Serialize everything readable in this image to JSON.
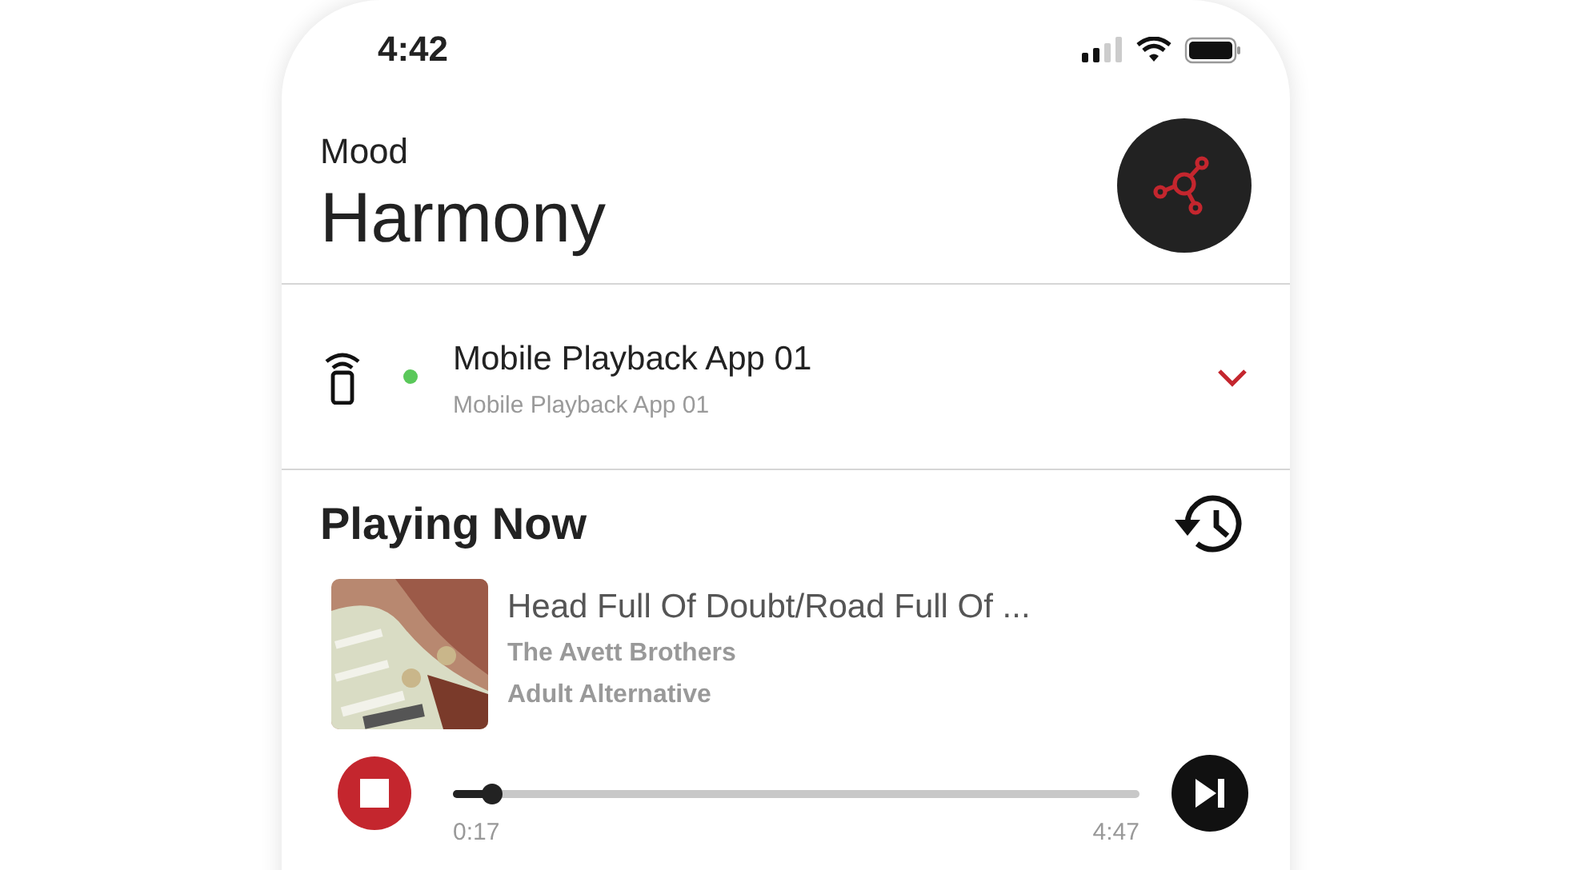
{
  "status_bar": {
    "time": "4:42"
  },
  "header": {
    "label": "Mood",
    "title": "Harmony"
  },
  "device": {
    "name": "Mobile Playback App 01",
    "subtitle": "Mobile Playback App 01",
    "connected": true
  },
  "now_playing": {
    "heading": "Playing Now",
    "track": {
      "title": "Head Full Of Doubt/Road Full Of ...",
      "artist": "The Avett Brothers",
      "genre": "Adult Alternative"
    },
    "progress": {
      "level": 0.055,
      "elapsed": "0:17",
      "total": "4:47"
    }
  }
}
